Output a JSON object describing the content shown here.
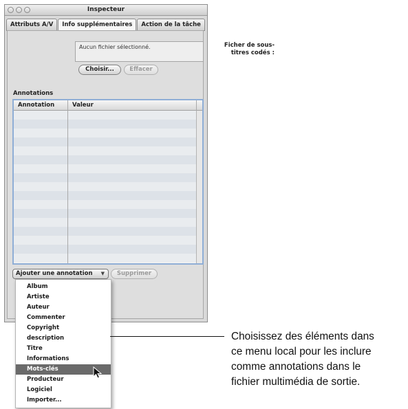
{
  "window": {
    "title": "Inspecteur",
    "tabs": [
      "Attributs A/V",
      "Info supplémentaires",
      "Action de la tâche"
    ]
  },
  "subtitles": {
    "label_line1": "Ficher de sous-",
    "label_line2": "titres codés :",
    "value": "Aucun fichier sélectionné.",
    "choose_button": "Choisir...",
    "clear_button": "Effacer"
  },
  "annotations": {
    "section_label": "Annotations",
    "columns": [
      "Annotation",
      "Valeur"
    ],
    "add_popup": "Ajouter une annotation",
    "remove_button": "Supprimer"
  },
  "menu": {
    "items": [
      "Album",
      "Artiste",
      "Auteur",
      "Commenter",
      "Copyright",
      "description",
      "Titre",
      "Informations",
      "Mots-clés",
      "Producteur",
      "Logiciel",
      "Importer..."
    ],
    "highlighted_item": "Mots-clés"
  },
  "callout": {
    "lines": [
      "Choisissez des éléments dans",
      "ce menu local pour les inclure",
      "comme annotations dans le",
      "fichier multimédia de sortie."
    ]
  },
  "colors": {
    "selection_highlight": "#6a6a6a",
    "table_focus_ring": "#8faed6",
    "window_background": "#d9d9d9"
  },
  "icons": {
    "window_controls": [
      "close-icon",
      "minimize-icon",
      "zoom-icon"
    ],
    "popup_arrow": "chevron-down-icon",
    "pointer": "mouse-pointer-icon"
  }
}
